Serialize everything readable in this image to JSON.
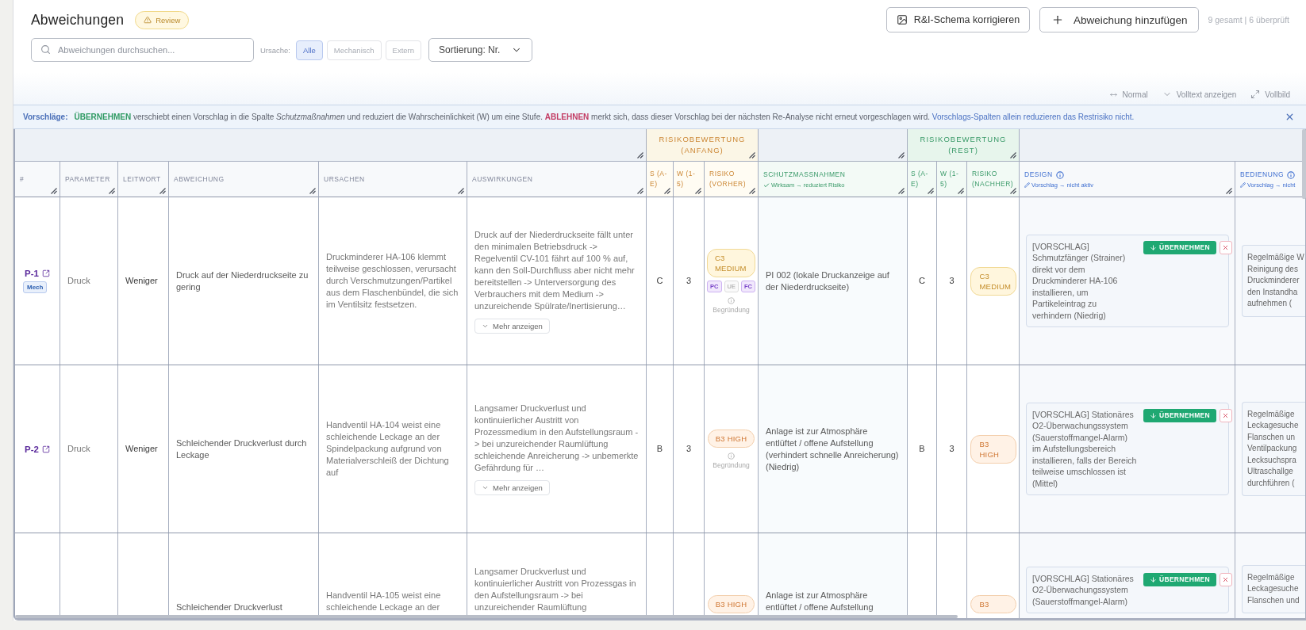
{
  "header": {
    "title": "Abweichungen",
    "badge": {
      "label": "Review"
    },
    "actions": [
      {
        "kind": "schema",
        "label": "R&I-Schema korrigieren"
      },
      {
        "kind": "add",
        "label": "Abweichung hinzufügen"
      }
    ],
    "summary": "9 gesamt | 6 überprüft"
  },
  "filters": {
    "search": {
      "placeholder": "Abweichungen durchsuchen..."
    },
    "cause_label": "Ursache:",
    "cause_chips": [
      {
        "label": "Alle",
        "selected": true
      },
      {
        "label": "Mechanisch",
        "selected": false
      },
      {
        "label": "Extern",
        "selected": false
      }
    ],
    "sort": {
      "value": "Sortierung: Nr."
    }
  },
  "view_toolbar": [
    {
      "kind": "density",
      "label": "Normal"
    },
    {
      "kind": "fulltext",
      "label": "Volltext anzeigen"
    },
    {
      "kind": "fullscreen",
      "label": "Vollbild"
    }
  ],
  "banner": {
    "label": "Vorschläge:",
    "segments": [
      {
        "kind": "accept",
        "text": "ÜBERNEHMEN"
      },
      {
        "kind": "plain",
        "text": "verschiebt einen Vorschlag in die Spalte *Schutzmaßnahmen* und reduziert die Wahrscheinlichkeit (W) um eine Stufe."
      },
      {
        "kind": "reject",
        "text": "ABLEHNEN"
      },
      {
        "kind": "plain",
        "text": "merkt sich, dass dieser Vorschlag bei der nächsten Re-Analyse nicht erneut vorgeschlagen wird."
      },
      {
        "kind": "note",
        "text": "Vorschlags-Spalten allein reduzieren das Restrisiko nicht."
      }
    ]
  },
  "table": {
    "groups": [
      {
        "kind": "neutral",
        "columns": [
          {
            "label": "#"
          },
          {
            "label": "PARAMETER"
          },
          {
            "label": "LEITWORT"
          },
          {
            "label": "ABWEICHUNG"
          },
          {
            "label": "URSACHEN"
          },
          {
            "label": "AUSWIRKUNGEN"
          }
        ]
      },
      {
        "kind": "initial",
        "title": "RISIKOBEWERTUNG (ANFANG)",
        "columns": [
          {
            "label": "S (A-E)"
          },
          {
            "label": "W (1-5)"
          },
          {
            "label": "RISIKO (VORHER)"
          }
        ]
      },
      {
        "kind": "measure",
        "columns": [
          {
            "label": "SCHUTZMASSNAHMEN",
            "note": "Wirksam → reduziert Risiko"
          }
        ]
      },
      {
        "kind": "rest",
        "title": "RISIKOBEWERTUNG (REST)",
        "columns": [
          {
            "label": "S (A-E)"
          },
          {
            "label": "W (1-5)"
          },
          {
            "label": "RISIKO (NACHHER)"
          }
        ]
      },
      {
        "kind": "suggestion",
        "columns": [
          {
            "label": "DESIGN",
            "note": "Vorschlag → nicht aktiv"
          },
          {
            "label": "BEDIENUNG",
            "note": "Vorschlag → nicht"
          }
        ]
      }
    ],
    "rows": [
      {
        "id": "P-1",
        "cause_tag": "Mech",
        "parameter": "Druck",
        "guideword": "Weniger",
        "deviation": "Druck auf der Niederdruckseite zu gering",
        "causes": "Druckminderer HA-106 klemmt teilweise geschlossen, verursacht durch Verschmutzungen/Partikel aus dem Flaschenbündel, die sich im Ventilsitz festsetzen.",
        "effects": "Druck auf der Niederdruckseite fällt unter den minimalen Betriebsdruck -> Regelventil CV-101 fährt auf 100 % auf, kann den Soll-Durchfluss aber nicht mehr bereitstellen -> Unterversorgung des Verbrauchers mit dem Medium -> unzureichende Spülrate/Inertisierung…",
        "more_label": "Mehr anzeigen",
        "s_initial": "C",
        "w_initial": "3",
        "risk_initial": {
          "label": "C3 MEDIUM",
          "kind": "medium",
          "tags": [
            {
              "label": "PC",
              "active": true
            },
            {
              "label": "UE",
              "active": false
            },
            {
              "label": "FC",
              "active": true
            }
          ],
          "reason_label": "Begründung"
        },
        "measures": "PI 002 (lokale Druckanzeige auf der Niederdruckseite)",
        "s_rest": "C",
        "w_rest": "3",
        "risk_rest": {
          "label": "C3 MEDIUM",
          "kind": "medium"
        },
        "design": {
          "text": "[VORSCHLAG] Schmutzfänger (Strainer) direkt vor dem Druckminderer HA-106 installieren, um Partikeleintrag zu verhindern (Niedrig)",
          "accept_label": "ÜBERNEHMEN"
        },
        "operation": {
          "lines": [
            "Regelmäßige W",
            "Reinigung des",
            "Druckminderer",
            "den Instandha",
            "aufnehmen ("
          ]
        }
      },
      {
        "id": "P-2",
        "parameter": "Druck",
        "guideword": "Weniger",
        "deviation": "Schleichender Druckverlust durch Leckage",
        "causes": "Handventil HA-104 weist eine schleichende Leckage an der Spindelpackung aufgrund von Materialverschleiß der Dichtung auf",
        "effects": "Langsamer Druckverlust und kontinuierlicher Austritt von Prozessmedium in den Aufstellungsraum -> bei unzureichender Raumlüftung schleichende Anreicherung -> unbemerkte Gefährdung für …",
        "more_label": "Mehr anzeigen",
        "s_initial": "B",
        "w_initial": "3",
        "risk_initial": {
          "label": "B3 HIGH",
          "kind": "high",
          "reason_label": "Begründung"
        },
        "measures": "Anlage ist zur Atmosphäre entlüftet / offene Aufstellung (verhindert schnelle Anreicherung) (Niedrig)",
        "s_rest": "B",
        "w_rest": "3",
        "risk_rest": {
          "label": "B3 HIGH",
          "kind": "high"
        },
        "design": {
          "text": "[VORSCHLAG] Stationäres O2-Überwachungssystem (Sauerstoffmangel-Alarm) im Aufstellungsbereich installieren, falls der Bereich teilweise umschlossen ist (Mittel)",
          "accept_label": "ÜBERNEHMEN"
        },
        "operation": {
          "lines": [
            "Regelmäßige",
            "Leckagesuche",
            "Flanschen un",
            "Ventilpackung",
            "Lecksuchspra",
            "Ultraschallge",
            "durchführen ("
          ]
        }
      },
      {
        "deviation": "Schleichender Druckverlust",
        "causes": "Handventil HA-105 weist eine schleichende Leckage an der",
        "effects": "Langsamer Druckverlust und kontinuierlicher Austritt von Prozessgas in den Aufstellungsraum -> bei unzureichender Raumlüftung",
        "risk_initial": {
          "label": "B3 HIGH",
          "kind": "high"
        },
        "measures": "Anlage ist zur Atmosphäre entlüftet / offene Aufstellung",
        "risk_rest": {
          "label": "B3",
          "kind": "high"
        },
        "design": {
          "text": "[VORSCHLAG] Stationäres O2-Überwachungssystem (Sauerstoffmangel-Alarm)",
          "accept_label": "ÜBERNEHMEN"
        },
        "operation": {
          "lines": [
            "Regelmäßige",
            "Leckagesuche",
            "Flanschen und"
          ]
        }
      }
    ]
  }
}
